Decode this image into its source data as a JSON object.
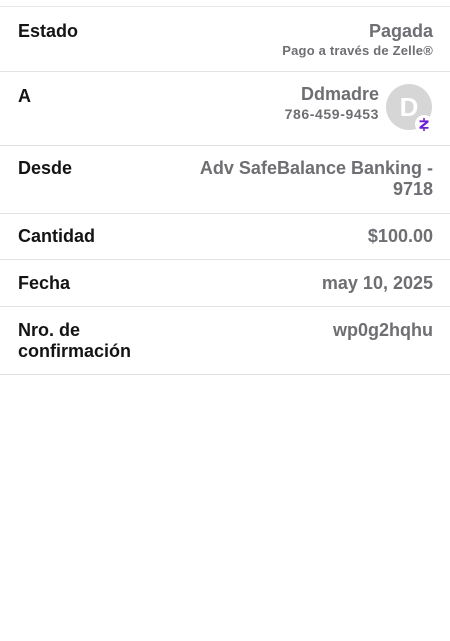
{
  "status": {
    "label": "Estado",
    "value": "Pagada",
    "note": "Pago a través de Zelle®"
  },
  "to": {
    "label": "A",
    "name": "Ddmadre",
    "phone": "786-459-9453",
    "avatar_initial": "D",
    "badge_icon": "zelle-logo-icon",
    "badge_color": "#6d1ed4"
  },
  "from": {
    "label": "Desde",
    "value": "Adv SafeBalance Banking -\n9718"
  },
  "amount": {
    "label": "Cantidad",
    "value": "$100.00"
  },
  "date": {
    "label": "Fecha",
    "value": "may 10, 2025"
  },
  "confirmation": {
    "label": "Nro. de\nconfirmación",
    "value": "wp0g2hqhu"
  }
}
